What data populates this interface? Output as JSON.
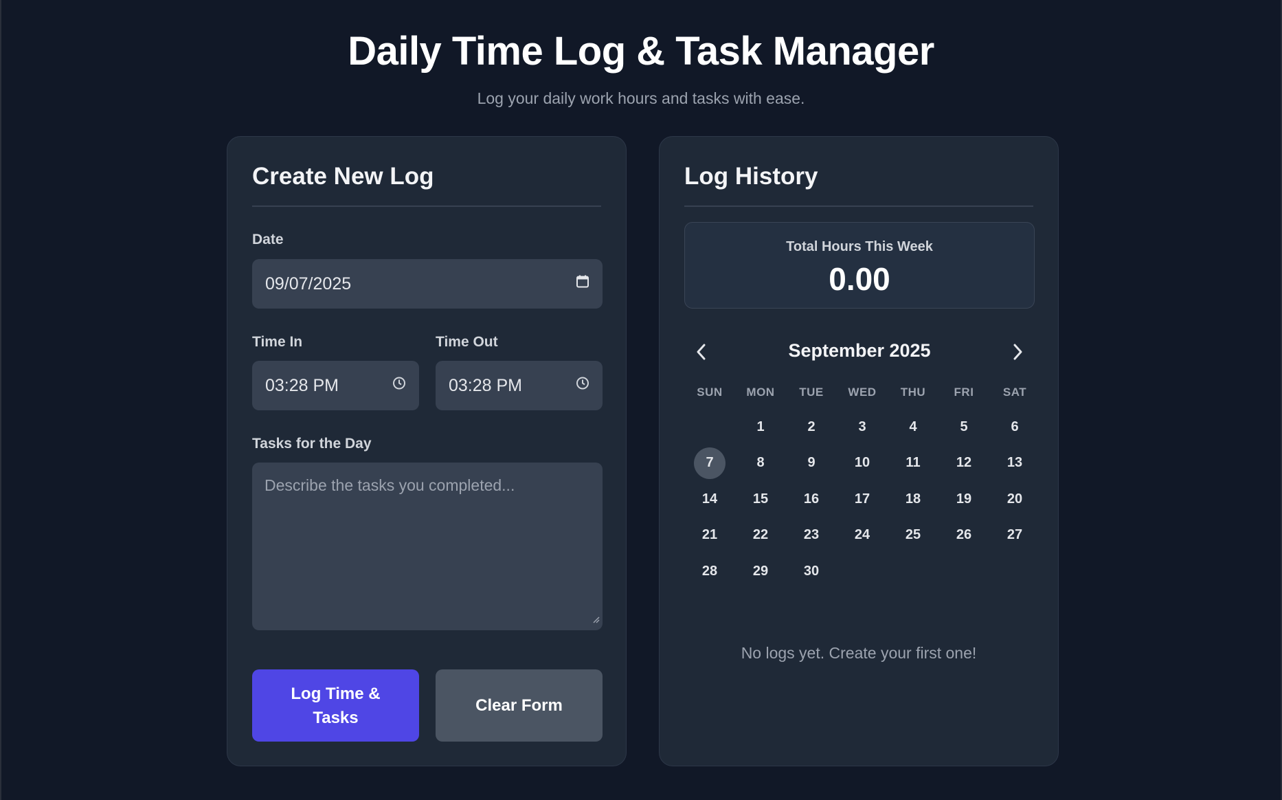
{
  "header": {
    "title": "Daily Time Log & Task Manager",
    "subtitle": "Log your daily work hours and tasks with ease."
  },
  "create_log": {
    "title": "Create New Log",
    "date_label": "Date",
    "date_value": "09/07/2025",
    "time_in_label": "Time In",
    "time_in_value": "03:28 PM",
    "time_out_label": "Time Out",
    "time_out_value": "03:28 PM",
    "tasks_label": "Tasks for the Day",
    "tasks_placeholder": "Describe the tasks you completed...",
    "log_button": "Log Time & Tasks",
    "clear_button": "Clear Form",
    "accent_color": "#4f46e5"
  },
  "history": {
    "title": "Log History",
    "total_label": "Total Hours This Week",
    "total_value": "0.00",
    "month_label": "September 2025",
    "weekdays": [
      "SUN",
      "MON",
      "TUE",
      "WED",
      "THU",
      "FRI",
      "SAT"
    ],
    "first_weekday_offset": 1,
    "days_in_month": 30,
    "today": 7,
    "empty_message": "No logs yet. Create your first one!"
  },
  "icons": {
    "date": "calendar-icon",
    "time": "clock-icon",
    "prev": "chevron-left-icon",
    "next": "chevron-right-icon"
  }
}
